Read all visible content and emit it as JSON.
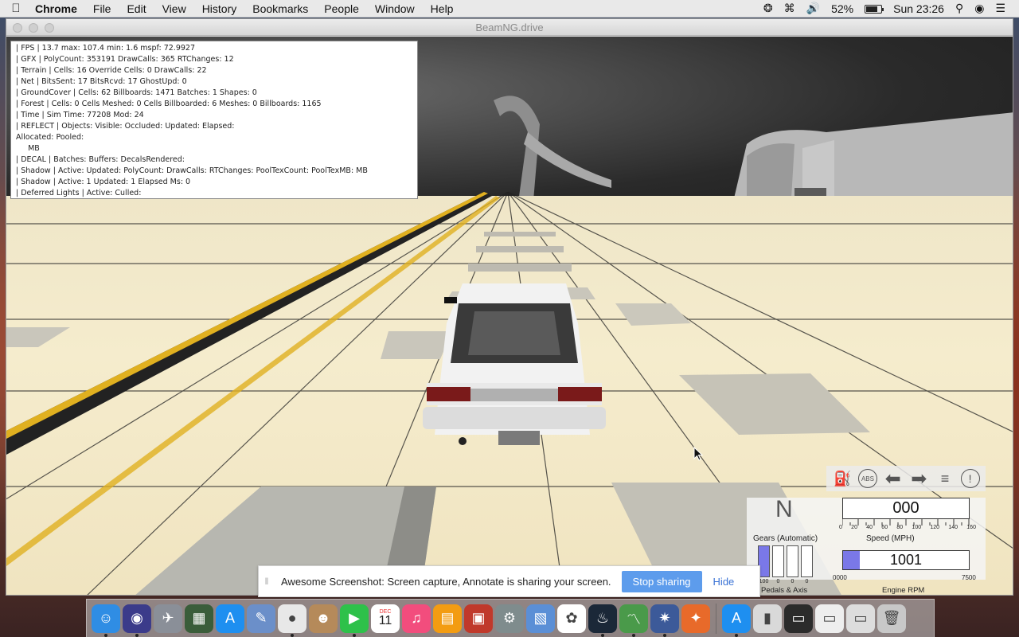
{
  "menubar": {
    "app_name": "Chrome",
    "menus": [
      "File",
      "Edit",
      "View",
      "History",
      "Bookmarks",
      "People",
      "Window",
      "Help"
    ],
    "battery_percent": "52%",
    "battery_level": 0.52,
    "clock": "Sun 23:26"
  },
  "window": {
    "title": "BeamNG.drive"
  },
  "debug_overlay": {
    "lines": [
      "| FPS |  13.7  max: 107.4  min:  1.6  mspf: 72.9927",
      "| GFX |  PolyCount: 353191  DrawCalls: 365  RTChanges: 12",
      "| Terrain |  Cells: 16  Override Cells: 0  DrawCalls: 22",
      "| Net |  BitsSent: 17  BitsRcvd: 17  GhostUpd: 0",
      "| GroundCover |  Cells: 62  Billboards: 1471  Batches: 1  Shapes: 0",
      "| Forest |  Cells: 0  Cells Meshed: 0  Cells Billboarded: 6  Meshes: 0  Billboards: 1165",
      "| Time |  Sim Time: 77208  Mod: 24",
      "| REFLECT |  Objects:    Visible:    Occluded:    Updated:    Elapsed:",
      "Allocated:    Pooled:",
      "     MB",
      "| DECAL | Batches:   Buffers:   DecalsRendered:",
      "| Shadow |  Active:   Updated:   PolyCount:    DrawCalls:    RTChanges:    PoolTexCount:    PoolTexMB: MB",
      "| Shadow |  Active: 1  Updated: 1  Elapsed Ms: 0",
      "| Deferred Lights |  Active:    Culled:"
    ]
  },
  "dashboard": {
    "gear": "N",
    "gear_label": "Gears (Automatic)",
    "speed": "000",
    "speed_label": "Speed (MPH)",
    "speed_ticks": [
      "0",
      "20",
      "40",
      "60",
      "80",
      "100",
      "120",
      "140",
      "160"
    ],
    "rpm": "1001",
    "rpm_min": "0000",
    "rpm_max": "7500",
    "rpm_fraction": 0.13,
    "rpm_label": "Engine RPM",
    "pedals_label": "Pedals & Axis",
    "pedal_values": [
      "100",
      "0",
      "0",
      "0"
    ],
    "pedal_levels": [
      1,
      0,
      0,
      0
    ],
    "icons": [
      "fuel-icon",
      "abs-icon",
      "left-signal-icon",
      "right-signal-icon",
      "headlight-icon",
      "warning-icon"
    ],
    "abs_text": "ABS"
  },
  "sharebar": {
    "message": "Awesome Screenshot: Screen capture, Annotate is sharing your screen.",
    "stop_label": "Stop sharing",
    "hide_label": "Hide"
  },
  "dock": {
    "calendar_month": "DEC",
    "calendar_day": "11",
    "apps": [
      {
        "name": "finder",
        "color": "#2f8de4",
        "glyph": "☺"
      },
      {
        "name": "siri",
        "color": "#3b3b8a",
        "glyph": "◉"
      },
      {
        "name": "launchpad",
        "color": "#8a8f98",
        "glyph": "✈"
      },
      {
        "name": "mission-control",
        "color": "#3a5d3a",
        "glyph": "▦"
      },
      {
        "name": "app-store",
        "color": "#1e8ff0",
        "glyph": "A"
      },
      {
        "name": "preview",
        "color": "#6b8fc9",
        "glyph": "✎"
      },
      {
        "name": "chrome",
        "color": "#e8e8e8",
        "glyph": "●"
      },
      {
        "name": "contacts",
        "color": "#b58a5a",
        "glyph": "☻"
      },
      {
        "name": "facetime",
        "color": "#2ec14a",
        "glyph": "▶"
      },
      {
        "name": "calendar",
        "color": "#ffffff",
        "glyph": ""
      },
      {
        "name": "itunes",
        "color": "#f24d7d",
        "glyph": "♫"
      },
      {
        "name": "ibooks",
        "color": "#f39c12",
        "glyph": "▤"
      },
      {
        "name": "photo-booth",
        "color": "#c0392b",
        "glyph": "▣"
      },
      {
        "name": "system-preferences",
        "color": "#7f8c8d",
        "glyph": "⚙"
      },
      {
        "name": "image-capture",
        "color": "#5b8fd6",
        "glyph": "▧"
      },
      {
        "name": "photos",
        "color": "#ffffff",
        "glyph": "✿"
      },
      {
        "name": "steam",
        "color": "#1b2838",
        "glyph": "♨"
      },
      {
        "name": "activity-monitor",
        "color": "#4a9a4a",
        "glyph": "〽"
      },
      {
        "name": "beamng",
        "color": "#3c5a99",
        "glyph": "✷"
      },
      {
        "name": "network-tool",
        "color": "#e86a2a",
        "glyph": "✦"
      },
      {
        "name": "app-store-2",
        "color": "#1e8ff0",
        "glyph": "A"
      },
      {
        "name": "archive-utility",
        "color": "#d9d9d9",
        "glyph": "▮"
      },
      {
        "name": "screen-window",
        "color": "#2b2b2b",
        "glyph": "▭"
      },
      {
        "name": "document-window",
        "color": "#eeeeee",
        "glyph": "▭"
      },
      {
        "name": "browser-window",
        "color": "#dddddd",
        "glyph": "▭"
      },
      {
        "name": "trash",
        "color": "#c8c8c8",
        "glyph": "🗑"
      }
    ]
  }
}
